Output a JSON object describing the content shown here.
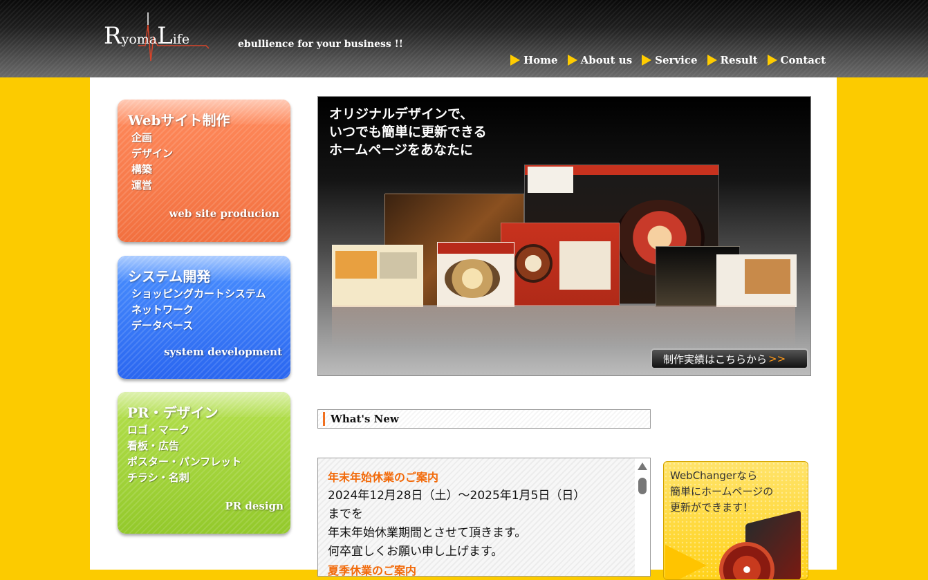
{
  "header": {
    "logo_text_r": "R",
    "logo_text_yoma": "yoma",
    "logo_text_l": "L",
    "logo_text_ife": "ife",
    "tagline": "ebullience for your business !!",
    "nav": [
      {
        "label": "Home"
      },
      {
        "label": "About us"
      },
      {
        "label": "Service"
      },
      {
        "label": "Result"
      },
      {
        "label": "Contact"
      }
    ]
  },
  "cards": {
    "web": {
      "title": "Webサイト制作",
      "items": [
        "企画",
        "デザイン",
        "構築",
        "運営"
      ],
      "subtitle": "web site producion"
    },
    "system": {
      "title": "システム開発",
      "items": [
        "ショッピングカートシステム",
        "ネットワーク",
        "データベース"
      ],
      "subtitle": "system development"
    },
    "pr": {
      "title": "PR・デザイン",
      "items": [
        "ロゴ・マーク",
        "看板・広告",
        "ポスター・パンフレット",
        "チラシ・名刺"
      ],
      "subtitle": "PR design"
    }
  },
  "banner": {
    "lines": [
      "オリジナルデザインで、",
      "いつでも簡単に更新できる",
      "ホームページをあなたに"
    ],
    "button_label": "制作実績はこちらから",
    "button_chevron": ">>"
  },
  "whats_new": {
    "heading": "What's New",
    "entries": [
      {
        "title": "年末年始休業のご案内",
        "lines": [
          "2024年12月28日（土）～2025年1月5日（日）",
          "までを",
          "年末年始休業期間とさせて頂きます。",
          "何卒宜しくお願い申し上げます。"
        ]
      },
      {
        "title": "夏季休業のご案内",
        "lines": []
      }
    ]
  },
  "webchanger": {
    "lines": [
      "WebChangerなら",
      "簡単にホームページの",
      "更新ができます！"
    ]
  },
  "colors": {
    "background": "#fccb00",
    "nav_arrow": "#ffcc00",
    "news_title": "#f26a0a",
    "card_web": "#f2703f",
    "card_system": "#2a66f0",
    "card_pr": "#93c92b"
  }
}
